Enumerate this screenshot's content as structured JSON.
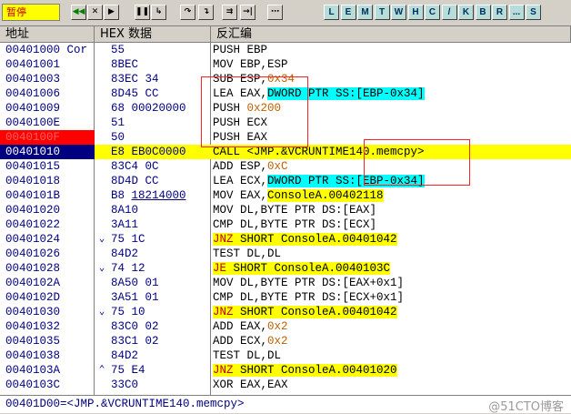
{
  "status": "暂停",
  "toolbar": {
    "buttons": [
      {
        "label": "◀◀",
        "name": "restart-icon",
        "style": "green"
      },
      {
        "label": "✕",
        "name": "close-icon",
        "style": "dark"
      },
      {
        "label": "▶",
        "name": "run-icon",
        "style": "dark"
      },
      {
        "label": "❚❚",
        "name": "pause-icon",
        "style": "dark"
      },
      {
        "label": "↳",
        "name": "step-into-icon",
        "style": "dark"
      },
      {
        "label": "↷",
        "name": "step-over-icon",
        "style": "dark"
      },
      {
        "label": "↴",
        "name": "trace-into-icon",
        "style": "dark"
      },
      {
        "label": "⇉",
        "name": "trace-over-icon",
        "style": "dark"
      },
      {
        "label": "→|",
        "name": "execute-till-return-icon",
        "style": "dark"
      },
      {
        "label": "⋯",
        "name": "goto-icon",
        "style": "dark"
      }
    ],
    "letters": [
      "L",
      "E",
      "M",
      "T",
      "W",
      "H",
      "C",
      "/",
      "K",
      "B",
      "R",
      "...",
      "S"
    ]
  },
  "headers": {
    "address": "地址",
    "hex": "HEX 数据",
    "disasm": "反汇编"
  },
  "rows": [
    {
      "addr": "00401000 Cor",
      "arrow": "",
      "hex": "55",
      "hex_ul": "",
      "state": "",
      "dis": [
        {
          "t": "PUSH EBP"
        }
      ]
    },
    {
      "addr": "00401001",
      "arrow": "",
      "hex": "8BEC",
      "hex_ul": "",
      "state": "",
      "dis": [
        {
          "t": "MOV EBP,ESP"
        }
      ]
    },
    {
      "addr": "00401003",
      "arrow": "",
      "hex": "83EC 34",
      "hex_ul": "",
      "state": "",
      "dis": [
        {
          "t": "SUB ESP,"
        },
        {
          "t": "0x34",
          "c": "num"
        }
      ]
    },
    {
      "addr": "00401006",
      "arrow": "",
      "hex": "8D45 CC",
      "hex_ul": "",
      "state": "",
      "dis": [
        {
          "t": "LEA EAX,"
        },
        {
          "t": "DWORD PTR SS:[EBP-0x34]",
          "c": "hl-cyan"
        }
      ]
    },
    {
      "addr": "00401009",
      "arrow": "",
      "hex": "68 00020000",
      "hex_ul": "",
      "state": "",
      "dis": [
        {
          "t": "PUSH "
        },
        {
          "t": "0x200",
          "c": "num"
        }
      ]
    },
    {
      "addr": "0040100E",
      "arrow": "",
      "hex": "51",
      "hex_ul": "",
      "state": "",
      "dis": [
        {
          "t": "PUSH ECX"
        }
      ]
    },
    {
      "addr": "0040100F",
      "arrow": "",
      "hex": "50",
      "hex_ul": "",
      "state": "bp",
      "dis": [
        {
          "t": "PUSH EAX"
        }
      ]
    },
    {
      "addr": "00401010",
      "arrow": "",
      "hex": "E8 EB0C0000",
      "hex_ul": "",
      "state": "eip",
      "dis": [
        {
          "t": "CALL <JMP.&VCRUNTIME140.memcpy>"
        }
      ]
    },
    {
      "addr": "00401015",
      "arrow": "",
      "hex": "83C4 0C",
      "hex_ul": "",
      "state": "",
      "dis": [
        {
          "t": "ADD ESP,"
        },
        {
          "t": "0xC",
          "c": "num"
        }
      ]
    },
    {
      "addr": "00401018",
      "arrow": "",
      "hex": "8D4D CC",
      "hex_ul": "",
      "state": "",
      "dis": [
        {
          "t": "LEA ECX,"
        },
        {
          "t": "DWORD PTR SS:[EBP-0x34]",
          "c": "hl-cyan"
        }
      ]
    },
    {
      "addr": "0040101B",
      "arrow": "",
      "hex": "B8 ",
      "hex_ul": "18214000",
      "state": "",
      "dis": [
        {
          "t": "MOV EAX,"
        },
        {
          "t": "ConsoleA.00402118",
          "c": "hl-yellow"
        }
      ]
    },
    {
      "addr": "00401020",
      "arrow": "",
      "hex": "8A10",
      "hex_ul": "",
      "state": "",
      "dis": [
        {
          "t": "MOV DL,BYTE PTR DS:[EAX]"
        }
      ]
    },
    {
      "addr": "00401022",
      "arrow": "",
      "hex": "3A11",
      "hex_ul": "",
      "state": "",
      "dis": [
        {
          "t": "CMP DL,BYTE PTR DS:[ECX]"
        }
      ]
    },
    {
      "addr": "00401024",
      "arrow": "⌄",
      "hex": "75 1C",
      "hex_ul": "",
      "state": "",
      "dis": [
        {
          "t": "JNZ",
          "c": "jcc"
        },
        {
          "t": " SHORT ConsoleA.00401042",
          "c": "hl-yellow"
        }
      ]
    },
    {
      "addr": "00401026",
      "arrow": "",
      "hex": "84D2",
      "hex_ul": "",
      "state": "",
      "dis": [
        {
          "t": "TEST DL,DL"
        }
      ]
    },
    {
      "addr": "00401028",
      "arrow": "⌄",
      "hex": "74 12",
      "hex_ul": "",
      "state": "",
      "dis": [
        {
          "t": "JE",
          "c": "jcc"
        },
        {
          "t": " SHORT ConsoleA.0040103C",
          "c": "hl-yellow"
        }
      ]
    },
    {
      "addr": "0040102A",
      "arrow": "",
      "hex": "8A50 01",
      "hex_ul": "",
      "state": "",
      "dis": [
        {
          "t": "MOV DL,BYTE PTR DS:[EAX+0x1]"
        }
      ]
    },
    {
      "addr": "0040102D",
      "arrow": "",
      "hex": "3A51 01",
      "hex_ul": "",
      "state": "",
      "dis": [
        {
          "t": "CMP DL,BYTE PTR DS:[ECX+0x1]"
        }
      ]
    },
    {
      "addr": "00401030",
      "arrow": "⌄",
      "hex": "75 10",
      "hex_ul": "",
      "state": "",
      "dis": [
        {
          "t": "JNZ",
          "c": "jcc"
        },
        {
          "t": " SHORT ConsoleA.00401042",
          "c": "hl-yellow"
        }
      ]
    },
    {
      "addr": "00401032",
      "arrow": "",
      "hex": "83C0 02",
      "hex_ul": "",
      "state": "",
      "dis": [
        {
          "t": "ADD EAX,"
        },
        {
          "t": "0x2",
          "c": "num"
        }
      ]
    },
    {
      "addr": "00401035",
      "arrow": "",
      "hex": "83C1 02",
      "hex_ul": "",
      "state": "",
      "dis": [
        {
          "t": "ADD ECX,"
        },
        {
          "t": "0x2",
          "c": "num"
        }
      ]
    },
    {
      "addr": "00401038",
      "arrow": "",
      "hex": "84D2",
      "hex_ul": "",
      "state": "",
      "dis": [
        {
          "t": "TEST DL,DL"
        }
      ]
    },
    {
      "addr": "0040103A",
      "arrow": "⌃",
      "hex": "75 E4",
      "hex_ul": "",
      "state": "",
      "dis": [
        {
          "t": "JNZ",
          "c": "jcc"
        },
        {
          "t": " SHORT ConsoleA.00401020",
          "c": "hl-yellow"
        }
      ]
    },
    {
      "addr": "0040103C",
      "arrow": "",
      "hex": "33C0",
      "hex_ul": "",
      "state": "",
      "dis": [
        {
          "t": "XOR EAX,EAX"
        }
      ]
    }
  ],
  "info": "00401D00=<JMP.&VCRUNTIME140.memcpy>",
  "watermark": "@51CTO博客",
  "colors": {
    "breakpoint": "#ff0000",
    "eip": "#000080",
    "selected_row": "#ffff00",
    "operand_highlight": "#00ffff",
    "annotation_box": "#ff2020"
  }
}
